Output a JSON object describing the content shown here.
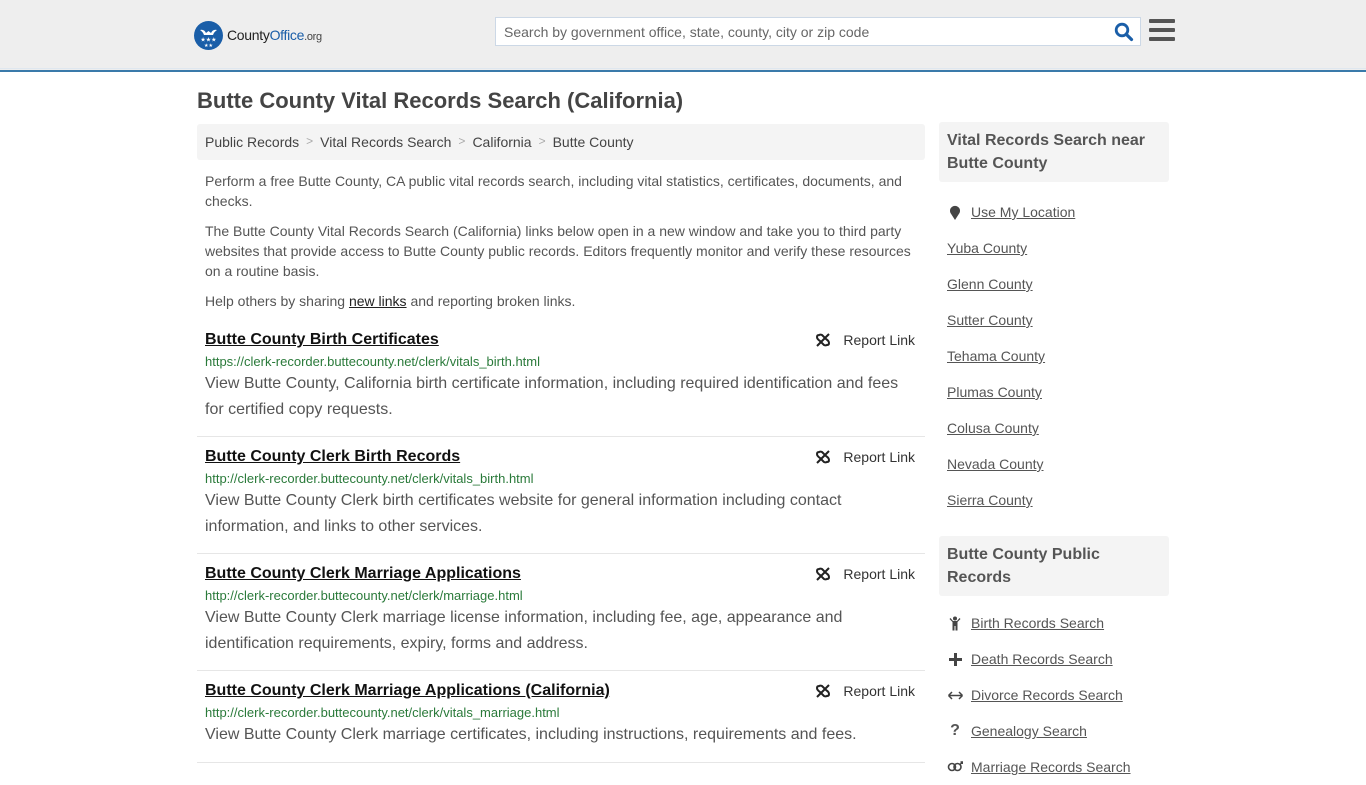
{
  "header": {
    "logo": {
      "name": "County",
      "brand": "Office",
      "tld": ".org"
    },
    "search": {
      "placeholder": "Search by government office, state, county, city or zip code",
      "value": ""
    },
    "icons": {
      "search": "search-icon",
      "menu": "hamburger-menu-icon"
    }
  },
  "page": {
    "title": "Butte County Vital Records Search (California)"
  },
  "breadcrumb": [
    {
      "label": "Public Records"
    },
    {
      "label": "Vital Records Search"
    },
    {
      "label": "California"
    },
    {
      "label": "Butte County"
    }
  ],
  "breadcrumb_separator": ">",
  "intro": {
    "p1": "Perform a free Butte County, CA public vital records search, including vital statistics, certificates, documents, and checks.",
    "p2": "The Butte County Vital Records Search (California) links below open in a new window and take you to third party websites that provide access to Butte County public records. Editors frequently monitor and verify these resources on a routine basis.",
    "p3_before": "Help others by sharing ",
    "p3_link": "new links",
    "p3_after": " and reporting broken links."
  },
  "results": [
    {
      "title": "Butte County Birth Certificates",
      "url": "https://clerk-recorder.buttecounty.net/clerk/vitals_birth.html",
      "description": "View Butte County, California birth certificate information, including required identification and fees for certified copy requests.",
      "report_label": "Report Link"
    },
    {
      "title": "Butte County Clerk Birth Records",
      "url": "http://clerk-recorder.buttecounty.net/clerk/vitals_birth.html",
      "description": "View Butte County Clerk birth certificates website for general information including contact information, and links to other services.",
      "report_label": "Report Link"
    },
    {
      "title": "Butte County Clerk Marriage Applications",
      "url": "http://clerk-recorder.buttecounty.net/clerk/marriage.html",
      "description": "View Butte County Clerk marriage license information, including fee, age, appearance and identification requirements, expiry, forms and address.",
      "report_label": "Report Link"
    },
    {
      "title": "Butte County Clerk Marriage Applications (California)",
      "url": "http://clerk-recorder.buttecounty.net/clerk/vitals_marriage.html",
      "description": "View Butte County Clerk marriage certificates, including instructions, requirements and fees.",
      "report_label": "Report Link"
    }
  ],
  "sidebar": {
    "nearby": {
      "heading": "Vital Records Search near Butte County",
      "location_label": "Use My Location",
      "location_icon": "map-pin-icon",
      "counties": [
        "Yuba County",
        "Glenn County",
        "Sutter County",
        "Tehama County",
        "Plumas County",
        "Colusa County",
        "Nevada County",
        "Sierra County"
      ]
    },
    "public_records": {
      "heading": "Butte County Public Records",
      "items": [
        {
          "label": "Birth Records Search",
          "icon": "child-icon"
        },
        {
          "label": "Death Records Search",
          "icon": "plus-icon"
        },
        {
          "label": "Divorce Records Search",
          "icon": "arrows-horizontal-icon"
        },
        {
          "label": "Genealogy Search",
          "icon": "question-icon"
        },
        {
          "label": "Marriage Records Search",
          "icon": "marriage-icon"
        }
      ]
    }
  },
  "colors": {
    "brand_blue": "#1a5ea8",
    "header_border": "#3a7aaa",
    "url_green": "#2a7a3a",
    "header_bg": "#eeeeee"
  }
}
